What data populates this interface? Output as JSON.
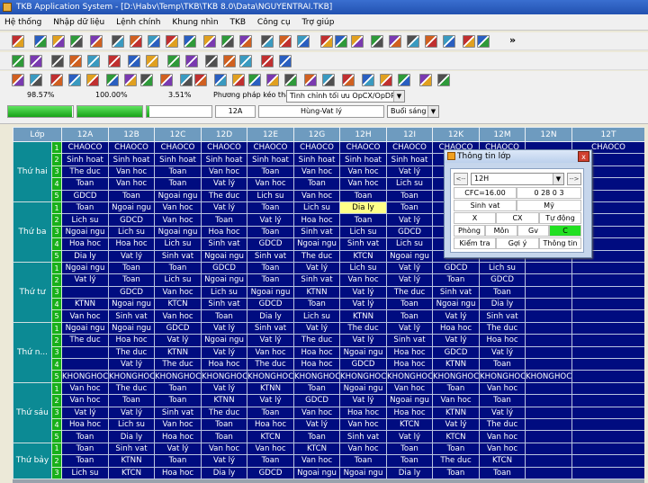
{
  "window": {
    "title": "TKB Application System - [D:\\Habv\\Temp\\TKB\\TKB 8.0\\Data\\NGUYENTRAI.TKB]"
  },
  "menu": [
    "Hệ thống",
    "Nhập dữ liệu",
    "Lệnh chính",
    "Khung nhìn",
    "TKB",
    "Công cụ",
    "Trợ giúp"
  ],
  "status": {
    "pct1": "98.57%",
    "pct2": "100.00%",
    "pct3": "3.51%",
    "progress": [
      0.99,
      1.0,
      0.035
    ],
    "method_label": "Phương pháp kéo thả:",
    "method_value": "Tinh chỉnh tối ưu OpCX/OpDPR",
    "class_value": "12A",
    "teacher_value": "Hùng-Vat lý",
    "session_value": "Buổi sáng"
  },
  "grid": {
    "corner": "Lớp",
    "classes": [
      "12A",
      "12B",
      "12C",
      "12D",
      "12E",
      "12G",
      "12H",
      "12I",
      "12K",
      "12M",
      "12N",
      "12T"
    ],
    "days": [
      {
        "name": "Thứ hai",
        "rows": [
          [
            "CHAOCO",
            "CHAOCO",
            "CHAOCO",
            "CHAOCO",
            "CHAOCO",
            "CHAOCO",
            "CHAOCO",
            "CHAOCO",
            "CHAOCO",
            "CHAOCO",
            "",
            "CHAOCO"
          ],
          [
            "Sinh hoat",
            "Sinh hoat",
            "Sinh hoat",
            "Sinh hoat",
            "Sinh hoat",
            "Sinh hoat",
            "Sinh hoat",
            "Sinh hoat",
            "",
            "",
            "",
            ""
          ],
          [
            "The duc",
            "Van hoc",
            "Toan",
            "Van hoc",
            "Toan",
            "Van hoc",
            "Van hoc",
            "Vat lý",
            "",
            "",
            "",
            ""
          ],
          [
            "Toan",
            "Van hoc",
            "Toan",
            "Vat lý",
            "Van hoc",
            "Toan",
            "Van hoc",
            "Lich su",
            "",
            "",
            "",
            ""
          ],
          [
            "GDCD",
            "Toan",
            "Ngoai ngu",
            "The duc",
            "Lich su",
            "Van hoc",
            "Toan",
            "Toan",
            "",
            "",
            "",
            ""
          ]
        ]
      },
      {
        "name": "Thứ ba",
        "rows": [
          [
            "Toan",
            "Ngoai ngu",
            "Van hoc",
            "Vat lý",
            "Toan",
            "Lich su",
            "Dia ly",
            "Toan",
            "",
            "",
            "",
            ""
          ],
          [
            "Lich su",
            "GDCD",
            "Van hoc",
            "Toan",
            "Vat lý",
            "Hoa hoc",
            "Toan",
            "Vat lý",
            "",
            "",
            "",
            ""
          ],
          [
            "Ngoai ngu",
            "Lich su",
            "Ngoai ngu",
            "Hoa hoc",
            "Toan",
            "Sinh vat",
            "Lich su",
            "GDCD",
            "",
            "",
            "",
            ""
          ],
          [
            "Hoa hoc",
            "Hoa hoc",
            "Lich su",
            "Sinh vat",
            "GDCD",
            "Ngoai ngu",
            "Sinh vat",
            "Lich su",
            "",
            "",
            "",
            ""
          ],
          [
            "Dia ly",
            "Vat lý",
            "Sinh vat",
            "Ngoai ngu",
            "Sinh vat",
            "The duc",
            "KTCN",
            "Ngoai ngu",
            "",
            "",
            "",
            ""
          ]
        ]
      },
      {
        "name": "Thứ tư",
        "rows": [
          [
            "Ngoai ngu",
            "Toan",
            "Toan",
            "GDCD",
            "Toan",
            "Vat lý",
            "Lich su",
            "Vat lý",
            "GDCD",
            "Lich su",
            "",
            ""
          ],
          [
            "Vat lý",
            "Toan",
            "Lich su",
            "Ngoai ngu",
            "Toan",
            "Sinh vat",
            "Van hoc",
            "Vat lý",
            "Toan",
            "GDCD",
            "",
            ""
          ],
          [
            "",
            "GDCD",
            "Van hoc",
            "Lich su",
            "Ngoai ngu",
            "KTNN",
            "Vat lý",
            "The duc",
            "Sinh vat",
            "Toan",
            "",
            ""
          ],
          [
            "KTNN",
            "Ngoai ngu",
            "KTCN",
            "Sinh vat",
            "GDCD",
            "Toan",
            "Vat lý",
            "Toan",
            "Ngoai ngu",
            "Dia ly",
            "",
            ""
          ],
          [
            "Van hoc",
            "Sinh vat",
            "Van hoc",
            "Toan",
            "Dia ly",
            "Lich su",
            "KTNN",
            "Toan",
            "Vat lý",
            "Sinh vat",
            "",
            ""
          ]
        ]
      },
      {
        "name": "Thứ n...",
        "rows": [
          [
            "Ngoai ngu",
            "Ngoai ngu",
            "GDCD",
            "Vat lý",
            "Sinh vat",
            "Vat lý",
            "The duc",
            "Vat lý",
            "Hoa hoc",
            "The duc",
            "",
            ""
          ],
          [
            "The duc",
            "Hoa hoc",
            "Vat lý",
            "Ngoai ngu",
            "Vat lý",
            "The duc",
            "Vat lý",
            "Sinh vat",
            "Vat lý",
            "Hoa hoc",
            "",
            ""
          ],
          [
            "",
            "The duc",
            "KTNN",
            "Vat lý",
            "Van hoc",
            "Hoa hoc",
            "Ngoai ngu",
            "Hoa hoc",
            "GDCD",
            "Vat lý",
            "",
            ""
          ],
          [
            "",
            "Vat lý",
            "The duc",
            "Hoa hoc",
            "The duc",
            "Hoa hoc",
            "GDCD",
            "Hoa hoc",
            "KTNN",
            "Toan",
            "",
            ""
          ],
          [
            "KHONGHOC",
            "KHONGHOC",
            "KHONGHOC",
            "KHONGHOC",
            "KHONGHOC",
            "KHONGHOC",
            "KHONGHOC",
            "KHONGHOC",
            "KHONGHOC",
            "KHONGHOC",
            "KHONGHOC",
            ""
          ]
        ]
      },
      {
        "name": "Thứ sáu",
        "rows": [
          [
            "Van hoc",
            "The duc",
            "Toan",
            "Vat lý",
            "KTNN",
            "Toan",
            "Ngoai ngu",
            "Van hoc",
            "Toan",
            "Van hoc",
            "",
            ""
          ],
          [
            "Van hoc",
            "Toan",
            "Toan",
            "KTNN",
            "Vat lý",
            "GDCD",
            "Vat lý",
            "Ngoai ngu",
            "Van hoc",
            "Toan",
            "",
            ""
          ],
          [
            "Vat lý",
            "Vat lý",
            "Sinh vat",
            "The duc",
            "Toan",
            "Van hoc",
            "Hoa hoc",
            "Hoa hoc",
            "KTNN",
            "Vat lý",
            "",
            ""
          ],
          [
            "Hoa hoc",
            "Lich su",
            "Van hoc",
            "Toan",
            "Hoa hoc",
            "Vat lý",
            "Van hoc",
            "KTCN",
            "Vat lý",
            "The duc",
            "",
            ""
          ],
          [
            "Toan",
            "Dia ly",
            "Hoa hoc",
            "Toan",
            "KTCN",
            "Toan",
            "Sinh vat",
            "Vat lý",
            "KTCN",
            "Van hoc",
            "",
            ""
          ]
        ]
      },
      {
        "name": "Thứ bảy",
        "rows": [
          [
            "Toan",
            "Sinh vat",
            "Vat lý",
            "Van hoc",
            "Van hoc",
            "KTCN",
            "Van hoc",
            "Toan",
            "Toan",
            "Van hoc",
            "",
            ""
          ],
          [
            "Toan",
            "KTNN",
            "Toan",
            "Vat lý",
            "Toan",
            "Van hoc",
            "Toan",
            "Toan",
            "The duc",
            "KTCN",
            "",
            ""
          ],
          [
            "Lich su",
            "KTCN",
            "Hoa hoc",
            "Dia ly",
            "GDCD",
            "Ngoai ngu",
            "Ngoai ngu",
            "Dia ly",
            "Toan",
            "Toan",
            "",
            ""
          ]
        ]
      }
    ]
  },
  "popup": {
    "title": "Thông tin lớp",
    "close": "x",
    "nav_prev": "<--",
    "nav_next": "-->",
    "class_combo": "12H",
    "cfc": "CFC=16.00",
    "code": "0 28 0 3",
    "subject_a": "Sinh vat",
    "subject_b": "Mỹ",
    "x": "X",
    "cx": "CX",
    "auto": "Tự động",
    "room": "Phòng",
    "subject_lbl": "Môn",
    "teacher_lbl": "Gv",
    "c": "C",
    "check": "Kiểm tra",
    "suggest": "Gợi ý",
    "info": "Thông tin"
  }
}
